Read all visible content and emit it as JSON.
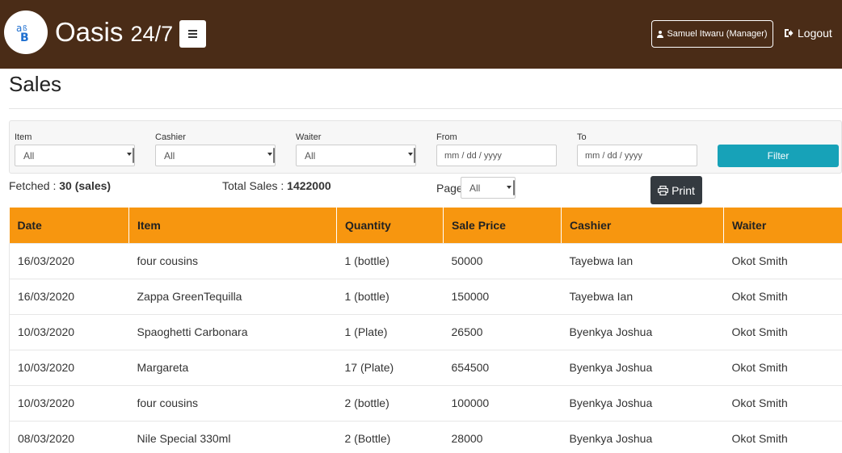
{
  "header": {
    "brand_name": "Oasis",
    "brand_suffix": "24/7",
    "logo_icon": "logo-icon",
    "menu_icon": "hamburger-icon",
    "user_label": "Samuel Itwaru (Manager)",
    "logout_label": "Logout",
    "bg_color": "#4a2c17"
  },
  "page": {
    "title": "Sales"
  },
  "filters": {
    "item": {
      "label": "Item",
      "value": "All"
    },
    "cashier": {
      "label": "Cashier",
      "value": "All"
    },
    "waiter": {
      "label": "Waiter",
      "value": "All"
    },
    "from": {
      "label": "From",
      "placeholder": "mm / dd / yyyy"
    },
    "to": {
      "label": "To",
      "placeholder": "mm / dd / yyyy"
    },
    "filter_button": "Filter",
    "filter_button_color": "#17a2b8"
  },
  "summary": {
    "fetched_label": "Fetched :",
    "fetched_value": "30 (sales)",
    "total_label": "Total Sales :",
    "total_value": "1422000",
    "page_label": "Page",
    "page_value": "All",
    "print_label": "Print"
  },
  "table": {
    "header_color": "#f7960f",
    "columns": [
      "Date",
      "Item",
      "Quantity",
      "Sale Price",
      "Cashier",
      "Waiter"
    ],
    "rows": [
      [
        "16/03/2020",
        "four cousins",
        "1 (bottle)",
        "50000",
        "Tayebwa Ian",
        "Okot Smith"
      ],
      [
        "16/03/2020",
        "Zappa GreenTequilla",
        "1 (bottle)",
        "150000",
        "Tayebwa Ian",
        "Okot Smith"
      ],
      [
        "10/03/2020",
        "Spaoghetti Carbonara",
        "1 (Plate)",
        "26500",
        "Byenkya Joshua",
        "Okot Smith"
      ],
      [
        "10/03/2020",
        "Margareta",
        "17 (Plate)",
        "654500",
        "Byenkya Joshua",
        "Okot Smith"
      ],
      [
        "10/03/2020",
        "four cousins",
        "2 (bottle)",
        "100000",
        "Byenkya Joshua",
        "Okot Smith"
      ],
      [
        "08/03/2020",
        "Nile Special 330ml",
        "2 (Bottle)",
        "28000",
        "Byenkya Joshua",
        "Okot Smith"
      ]
    ]
  }
}
